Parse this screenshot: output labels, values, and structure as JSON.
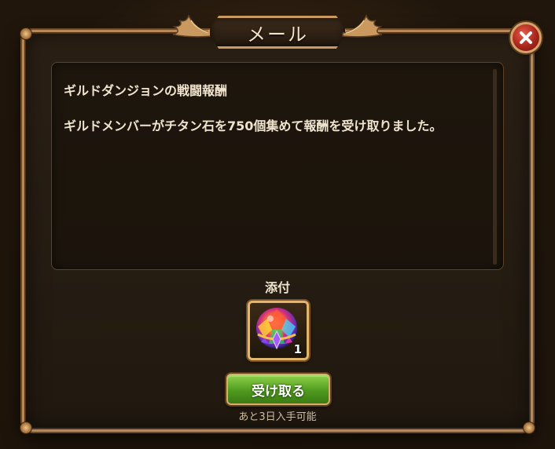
{
  "dialog": {
    "title": "メール"
  },
  "message": {
    "subject": "ギルドダンジョンの戦闘報酬",
    "body": "ギルドメンバーがチタン石を750個集めて報酬を受け取りました。"
  },
  "attachment": {
    "label": "添付",
    "items": [
      {
        "icon": "gem-orb-icon",
        "quantity": "1"
      }
    ]
  },
  "actions": {
    "receive_label": "受け取る",
    "expire_note": "あと3日入手可能"
  },
  "colors": {
    "frame_gold": "#b7895a",
    "text_cream": "#f1e4cf",
    "button_green": "#4f9a1e",
    "close_red": "#a8261c"
  }
}
